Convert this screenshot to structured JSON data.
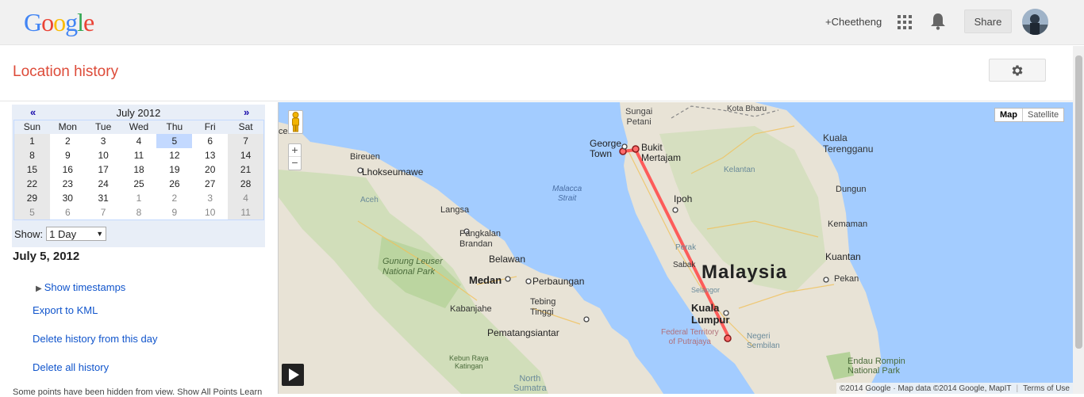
{
  "header": {
    "logo_letters": [
      "G",
      "o",
      "o",
      "g",
      "l",
      "e"
    ],
    "logo_colors": [
      "#4285f4",
      "#ea4335",
      "#fbbc05",
      "#4285f4",
      "#34a853",
      "#ea4335"
    ],
    "user": "+Cheetheng",
    "share": "Share",
    "apps_icon": "apps-grid-icon",
    "notifications_icon": "bell-icon"
  },
  "page": {
    "title": "Location history",
    "settings_icon": "gear-icon"
  },
  "calendar": {
    "prev": "«",
    "next": "»",
    "month": "July 2012",
    "weekdays": [
      "Sun",
      "Mon",
      "Tue",
      "Wed",
      "Thu",
      "Fri",
      "Sat"
    ],
    "weeks": [
      [
        "1",
        "2",
        "3",
        "4",
        "5",
        "6",
        "7"
      ],
      [
        "8",
        "9",
        "10",
        "11",
        "12",
        "13",
        "14"
      ],
      [
        "15",
        "16",
        "17",
        "18",
        "19",
        "20",
        "21"
      ],
      [
        "22",
        "23",
        "24",
        "25",
        "26",
        "27",
        "28"
      ],
      [
        "29",
        "30",
        "31",
        "1",
        "2",
        "3",
        "4"
      ],
      [
        "5",
        "6",
        "7",
        "8",
        "9",
        "10",
        "11"
      ]
    ],
    "selected": "5"
  },
  "show": {
    "label": "Show:",
    "value": "1 Day"
  },
  "sidebar": {
    "date": "July 5, 2012",
    "show_timestamps": "Show timestamps",
    "export_kml": "Export to KML",
    "delete_day": "Delete history from this day",
    "delete_all": "Delete all history",
    "note": "Some points have been hidden from view. Show All Points Learn"
  },
  "map": {
    "type_map": "Map",
    "type_satellite": "Satellite",
    "zoom_in": "+",
    "zoom_out": "−",
    "attribution": "©2014 Google · Map data ©2014 Google, MapIT",
    "terms": "Terms of Use",
    "labels": {
      "sungai_petani": "Sungai\nPetani",
      "kota_bharu": "Kota Bharu",
      "george_town": "George\nTown",
      "bukit_mertajam": "Bukit\nMertajam",
      "bireuen": "Bireuen",
      "lhokseumawe": "Lhokseumawe",
      "malacca_strait": "Malacca\nStrait",
      "kuala_terengganu": "Kuala\nTerengganu",
      "kelantan": "Kelantan",
      "ipoh": "Ipoh",
      "dungun": "Dungun",
      "aceh": "Aceh",
      "langsa": "Langsa",
      "kemaman": "Kemaman",
      "pangkalan_brandan": "Pangkalan\nBrandan",
      "belawan": "Belawan",
      "gunung_leuser": "Gunung Leuser\nNational Park",
      "kuantan": "Kuantan",
      "malaysia": "Malaysia",
      "medan": "Medan",
      "perbaungan": "Perbaungan",
      "pekan": "Pekan",
      "tebing_tinggi": "Tebing\nTinggi",
      "kabanjahe": "Kabanjahe",
      "kuala_lumpur": "Kuala\nLumpur",
      "pematangsiantar": "Pematangsiantar",
      "putrajaya": "Federal Territory\nof Putrajaya",
      "negeri_sembilan": "Negeri\nSembilan",
      "kebun_raya": "Kebun Raya\nKatingan",
      "endau_rompin": "Endau Rompin\nNational Park",
      "north_sumatra": "North\nSumatra",
      "sabak": "Sabak",
      "perak": "Perak",
      "selangor": "Selangor",
      "ceh": "ceh"
    }
  }
}
